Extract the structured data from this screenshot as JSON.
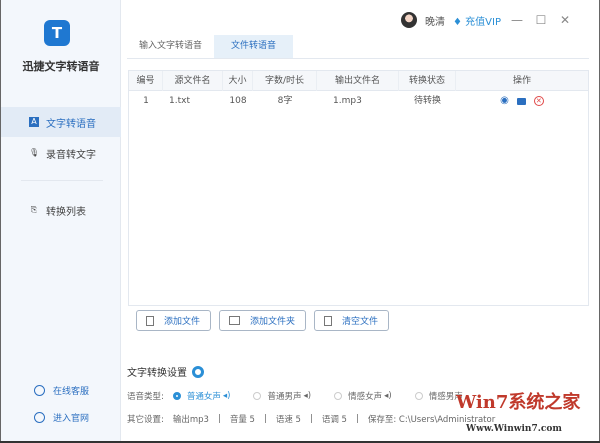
{
  "app": {
    "name": "迅捷文字转语音",
    "logo": "T"
  },
  "sidebar": {
    "items": [
      {
        "label": "文字转语音",
        "icon": "A"
      },
      {
        "label": "录音转文字",
        "icon": "🎙"
      },
      {
        "label": "转换列表",
        "icon": "⎘"
      }
    ],
    "footer": [
      {
        "label": "在线客服"
      },
      {
        "label": "进入官网"
      }
    ]
  },
  "header": {
    "user": "晚清",
    "vip": "充值VIP",
    "min": "—",
    "max": "☐",
    "close": "✕"
  },
  "tabs": [
    {
      "label": "输入文字转语音"
    },
    {
      "label": "文件转语音"
    }
  ],
  "table": {
    "headers": [
      "编号",
      "源文件名",
      "大小",
      "字数/时长",
      "输出文件名",
      "转换状态",
      "操作"
    ],
    "rows": [
      {
        "no": "1",
        "src": "1.txt",
        "size": "108",
        "count": "8字",
        "out": "1.mp3",
        "status": "待转换"
      }
    ]
  },
  "buttons": {
    "add_file": "添加文件",
    "add_folder": "添加文件夹",
    "clear": "清空文件"
  },
  "settings": {
    "title": "文字转换设置",
    "voice_label": "语音类型:",
    "voices": [
      "普通女声",
      "普通男声",
      "情感女声",
      "情感男声"
    ],
    "other_label": "其它设置:",
    "other": [
      "输出mp3",
      "音量 5",
      "语速 5",
      "语调 5",
      "保存至: C:\\Users\\Administrator"
    ]
  },
  "watermark": {
    "title": "Win7系统之家",
    "url": "Www.Winwin7.com"
  }
}
